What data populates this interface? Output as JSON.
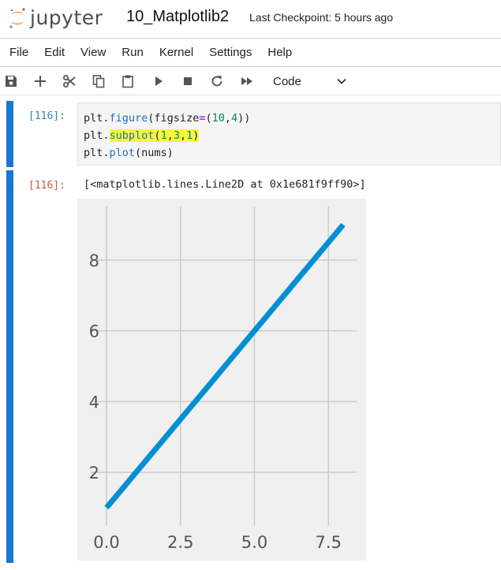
{
  "header": {
    "logo_text": "jupyter",
    "notebook_title": "10_Matplotlib2",
    "checkpoint": "Last Checkpoint: 5 hours ago"
  },
  "menu": [
    "File",
    "Edit",
    "View",
    "Run",
    "Kernel",
    "Settings",
    "Help"
  ],
  "toolbar": {
    "icons": [
      "save-icon",
      "add-cell-icon",
      "cut-icon",
      "copy-icon",
      "paste-icon",
      "run-icon",
      "stop-icon",
      "restart-icon",
      "fast-forward-icon"
    ],
    "cell_type": "Code"
  },
  "cells": {
    "input": {
      "prompt": "[116]:",
      "lines": [
        {
          "parts": [
            {
              "t": "plt.",
              "c": ""
            },
            {
              "t": "figure",
              "c": "fn"
            },
            {
              "t": "(figsize",
              "c": ""
            },
            {
              "t": "=",
              "c": "op"
            },
            {
              "t": "(",
              "c": ""
            },
            {
              "t": "10",
              "c": "num"
            },
            {
              "t": ",",
              "c": ""
            },
            {
              "t": "4",
              "c": "num"
            },
            {
              "t": "))",
              "c": ""
            }
          ]
        },
        {
          "parts": [
            {
              "t": "plt.",
              "c": ""
            },
            {
              "t": "subplot",
              "c": "fn hl"
            },
            {
              "t": "(",
              "c": "hl"
            },
            {
              "t": "1",
              "c": "num hl"
            },
            {
              "t": ",",
              "c": "hl"
            },
            {
              "t": "3",
              "c": "num hl"
            },
            {
              "t": ",",
              "c": "hl"
            },
            {
              "t": "1",
              "c": "num hl"
            },
            {
              "t": ")",
              "c": "hl"
            }
          ]
        },
        {
          "parts": [
            {
              "t": "plt.",
              "c": ""
            },
            {
              "t": "plot",
              "c": "fn"
            },
            {
              "t": "(nums)",
              "c": ""
            }
          ]
        }
      ]
    },
    "output": {
      "prompt": "[116]:",
      "text": "[<matplotlib.lines.Line2D at 0x1e681f9ff90>]"
    }
  },
  "chart_data": {
    "type": "line",
    "style": "fivethirtyeight",
    "x": [
      0,
      1,
      2,
      3,
      4,
      5,
      6,
      7,
      8
    ],
    "series": [
      {
        "values": [
          1,
          2,
          3,
          4,
          5,
          6,
          7,
          8,
          9
        ],
        "color": "#008fd5"
      }
    ],
    "xlim": [
      -0.4,
      8.4
    ],
    "ylim": [
      0.6,
      9.4
    ],
    "xticks": [
      0.0,
      2.5,
      5.0,
      7.5
    ],
    "xtick_labels": [
      "0.0",
      "2.5",
      "5.0",
      "7.5"
    ],
    "yticks": [
      2,
      4,
      6,
      8
    ],
    "ytick_labels": [
      "2",
      "4",
      "6",
      "8"
    ],
    "grid": true,
    "background": "#f0f0f0",
    "grid_color": "#cbcbcb",
    "tick_label_color": "#555555"
  }
}
